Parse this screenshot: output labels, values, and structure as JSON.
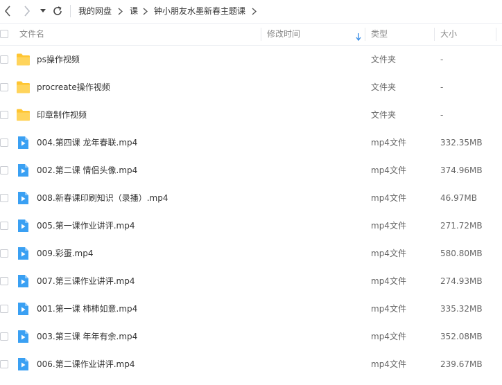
{
  "nav": {
    "breadcrumbs": [
      "我的网盘",
      "课",
      "钟小朋友水墨新春主题课"
    ]
  },
  "header": {
    "name": "文件名",
    "modified": "修改时间",
    "type": "类型",
    "size": "大小"
  },
  "colors": {
    "folder": "#ffc531",
    "video": "#3aa0f3"
  },
  "files": [
    {
      "name": "ps操作视频",
      "type": "文件夹",
      "size": "-",
      "kind": "folder"
    },
    {
      "name": "procreate操作视频",
      "type": "文件夹",
      "size": "-",
      "kind": "folder"
    },
    {
      "name": "印章制作视频",
      "type": "文件夹",
      "size": "-",
      "kind": "folder"
    },
    {
      "name": "004.第四课 龙年春联.mp4",
      "type": "mp4文件",
      "size": "332.35MB",
      "kind": "video"
    },
    {
      "name": "002.第二课 情侣头像.mp4",
      "type": "mp4文件",
      "size": "374.96MB",
      "kind": "video"
    },
    {
      "name": "008.新春课印刷知识（录播）.mp4",
      "type": "mp4文件",
      "size": "46.97MB",
      "kind": "video"
    },
    {
      "name": "005.第一课作业讲评.mp4",
      "type": "mp4文件",
      "size": "271.72MB",
      "kind": "video"
    },
    {
      "name": "009.彩蛋.mp4",
      "type": "mp4文件",
      "size": "580.80MB",
      "kind": "video"
    },
    {
      "name": "007.第三课作业讲评.mp4",
      "type": "mp4文件",
      "size": "274.93MB",
      "kind": "video"
    },
    {
      "name": "001.第一课 柿柿如意.mp4",
      "type": "mp4文件",
      "size": "335.32MB",
      "kind": "video"
    },
    {
      "name": "003.第三课 年年有余.mp4",
      "type": "mp4文件",
      "size": "352.08MB",
      "kind": "video"
    },
    {
      "name": "006.第二课作业讲评.mp4",
      "type": "mp4文件",
      "size": "239.67MB",
      "kind": "video"
    }
  ]
}
